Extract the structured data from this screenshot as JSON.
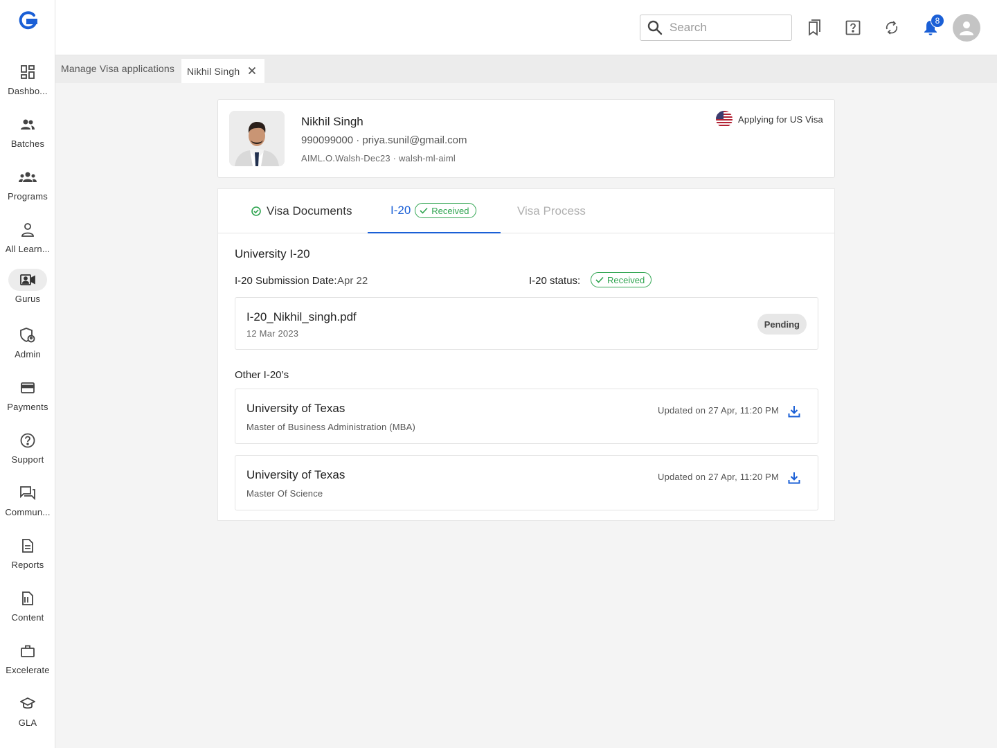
{
  "sidebar": {
    "items": [
      {
        "label": "Dashbo...",
        "icon": "dashboard-icon"
      },
      {
        "label": "Batches",
        "icon": "batches-icon"
      },
      {
        "label": "Programs",
        "icon": "programs-icon"
      },
      {
        "label": "All Learn...",
        "icon": "person-icon"
      },
      {
        "label": "Gurus",
        "icon": "video-person-icon"
      },
      {
        "label": "Admin",
        "icon": "admin-shield-icon"
      },
      {
        "label": "Payments",
        "icon": "credit-card-icon"
      },
      {
        "label": "Support",
        "icon": "help-circle-icon"
      },
      {
        "label": "Commun...",
        "icon": "chat-icon"
      },
      {
        "label": "Reports",
        "icon": "document-icon"
      },
      {
        "label": "Content",
        "icon": "content-icon"
      },
      {
        "label": "Excelerate",
        "icon": "briefcase-icon"
      },
      {
        "label": "GLA",
        "icon": "graduation-cap-icon"
      }
    ],
    "active_index": 4
  },
  "header": {
    "search_placeholder": "Search",
    "notification_count": "8"
  },
  "tabstrip": {
    "tab1": "Manage Visa applications",
    "tab2": "Nikhil Singh"
  },
  "profile": {
    "name": "Nikhil Singh",
    "contact": "990099000 · priya.sunil@gmail.com",
    "batch": "AIML.O.Walsh-Dec23 · walsh-ml-aiml",
    "applying": "Applying for US Visa"
  },
  "tabs": {
    "docs": "Visa Documents",
    "i20": "I-20",
    "i20_chip": "Received",
    "process": "Visa Process"
  },
  "i20": {
    "section_title": "University I-20",
    "submission_label": "I-20 Submission Date:",
    "submission_value": "Apr 22",
    "status_label": "I-20 status:",
    "status_value": "Received",
    "file": {
      "name": "I-20_Nikhil_singh.pdf",
      "date": "12 Mar 2023",
      "status": "Pending"
    },
    "other_title": "Other I-20’s",
    "others": [
      {
        "university": "University of Texas",
        "program": "Master of Business Administration (MBA)",
        "updated": "Updated on 27 Apr, 11:20 PM"
      },
      {
        "university": "University of Texas",
        "program": "Master Of Science",
        "updated": "Updated on 27 Apr, 11:20 PM"
      }
    ]
  },
  "colors": {
    "accent": "#1a5fd6",
    "success": "#2ea44f"
  }
}
